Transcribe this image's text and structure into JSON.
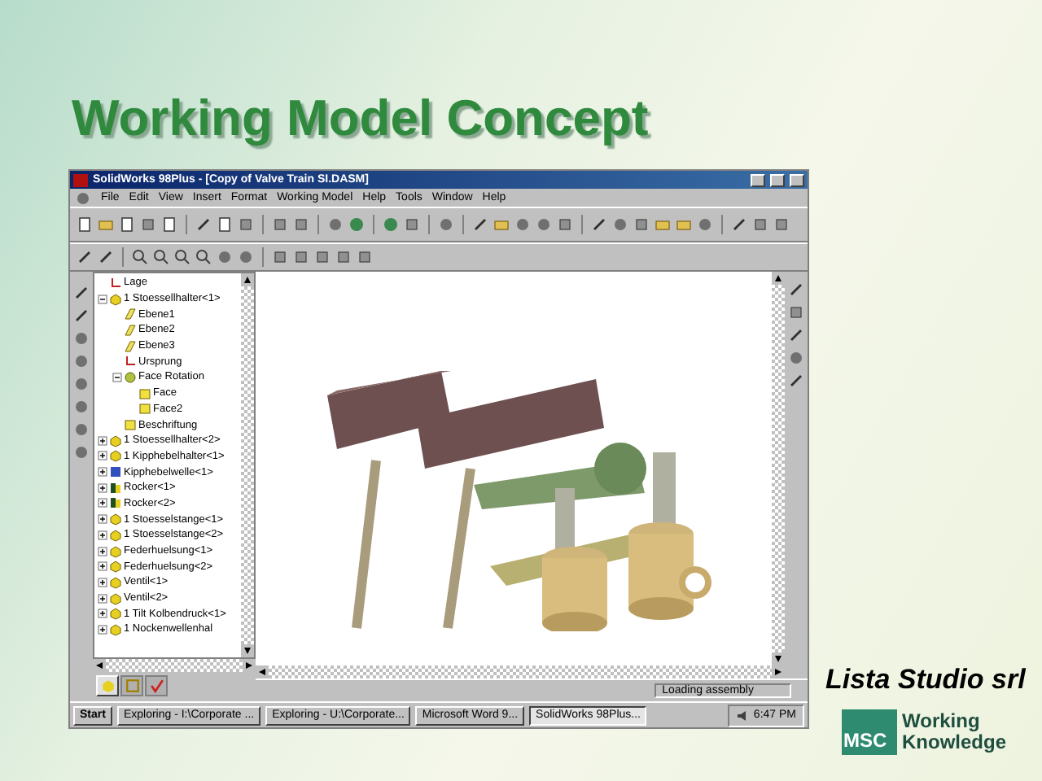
{
  "slide": {
    "title": "Working Model Concept",
    "company": "Lista Studio srl",
    "logo": {
      "mark": "MSC",
      "line1": "Working",
      "line2": "Knowledge"
    }
  },
  "window": {
    "title": "SolidWorks 98Plus - [Copy of Valve Train SI.DASM]",
    "menu": [
      "File",
      "Edit",
      "View",
      "Insert",
      "Format",
      "Working Model",
      "Help",
      "Tools",
      "Window",
      "Help"
    ],
    "tree": [
      {
        "label": "Lage",
        "kind": "origin"
      },
      {
        "label": "1 Stoessellhalter<1>",
        "kind": "part",
        "expanded": true,
        "children": [
          {
            "label": "Ebene1",
            "kind": "plane"
          },
          {
            "label": "Ebene2",
            "kind": "plane"
          },
          {
            "label": "Ebene3",
            "kind": "plane"
          },
          {
            "label": "Ursprung",
            "kind": "origin"
          },
          {
            "label": "Face Rotation",
            "kind": "feature",
            "expanded": true,
            "children": [
              {
                "label": "Face",
                "kind": "face"
              },
              {
                "label": "Face2",
                "kind": "face"
              }
            ]
          },
          {
            "label": "Beschriftung",
            "kind": "face"
          }
        ]
      },
      {
        "label": "1 Stoessellhalter<2>",
        "kind": "part",
        "expanded": false
      },
      {
        "label": "1 Kipphebelhalter<1>",
        "kind": "part",
        "expanded": false
      },
      {
        "label": "Kipphebelwelle<1>",
        "kind": "assembly",
        "expanded": false
      },
      {
        "label": "Rocker<1>",
        "kind": "rocker",
        "expanded": false
      },
      {
        "label": "Rocker<2>",
        "kind": "rocker",
        "expanded": false
      },
      {
        "label": "1 Stoesselstange<1>",
        "kind": "part",
        "expanded": false
      },
      {
        "label": "1 Stoesselstange<2>",
        "kind": "part",
        "expanded": false
      },
      {
        "label": "Federhuelsung<1>",
        "kind": "part",
        "expanded": false
      },
      {
        "label": "Federhuelsung<2>",
        "kind": "part",
        "expanded": false
      },
      {
        "label": "Ventil<1>",
        "kind": "part",
        "expanded": false
      },
      {
        "label": "Ventil<2>",
        "kind": "part",
        "expanded": false
      },
      {
        "label": "1 Tilt Kolbendruck<1>",
        "kind": "part",
        "expanded": false
      },
      {
        "label": "1 Nockenwellenhal",
        "kind": "part",
        "expanded": false
      }
    ],
    "tree_tabs": [
      {
        "selected": true
      },
      {
        "selected": false
      },
      {
        "selected": false
      }
    ],
    "status": "Loading assembly"
  },
  "taskbar": {
    "start": "Start",
    "tasks": [
      {
        "label": "Exploring - I:\\Corporate ...",
        "selected": false
      },
      {
        "label": "Exploring - U:\\Corporate...",
        "selected": false
      },
      {
        "label": "Microsoft Word 9...",
        "selected": false
      },
      {
        "label": "SolidWorks 98Plus...",
        "selected": true
      }
    ],
    "clock": "6:47 PM"
  }
}
